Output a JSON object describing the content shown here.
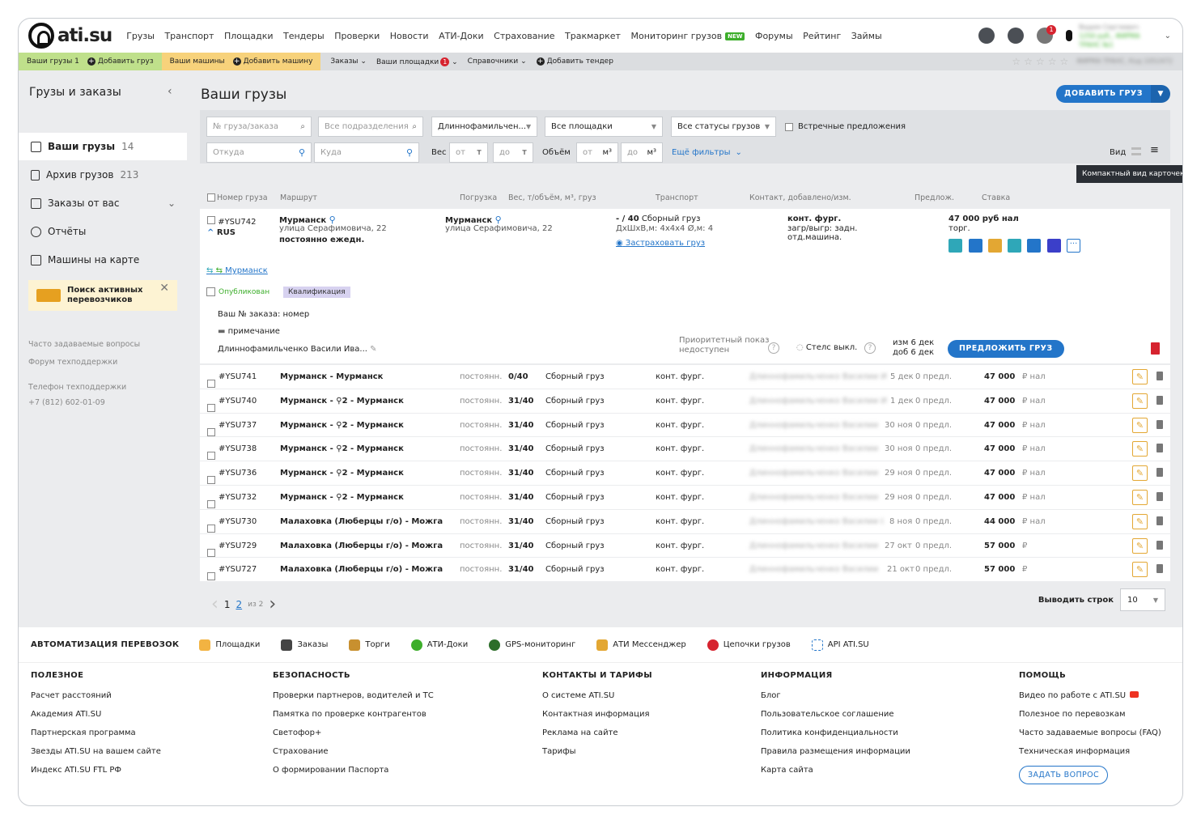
{
  "nav": {
    "logo": "ati.su",
    "items": [
      "Грузы",
      "Транспорт",
      "Площадки",
      "Тендеры",
      "Проверки",
      "Новости",
      "АТИ-Доки",
      "Страхование",
      "Тракмаркет",
      "Мониторинг грузов",
      "Форумы",
      "Рейтинг",
      "Займы"
    ],
    "new_badge": "NEW",
    "notif_count": "1",
    "user_name": "Вадим Сергеевич",
    "user_sub": "1250 руб., ФИРМА ТРАНС №1"
  },
  "subnav": {
    "cargo": "Ваши грузы 1",
    "add_cargo": "Добавить груз",
    "machines": "Ваши машины",
    "add_machine": "Добавить машину",
    "orders": "Заказы",
    "platforms": "Ваши площадки",
    "platforms_badge": "1",
    "refs": "Справочники",
    "add_tender": "Добавить тендер",
    "rating_blur": "ФИРМА ТРАНС, Код 1052472"
  },
  "sidebar": {
    "title": "Грузы и заказы",
    "items": [
      {
        "label": "Ваши грузы",
        "count": "14"
      },
      {
        "label": "Архив грузов",
        "count": "213"
      },
      {
        "label": "Заказы от вас",
        "count": ""
      },
      {
        "label": "Отчёты",
        "count": ""
      },
      {
        "label": "Машины на карте",
        "count": ""
      }
    ],
    "promo": "Поиск активных перевозчиков",
    "faq": "Часто задаваемые вопросы",
    "forum": "Форум техподдержки",
    "phone_label": "Телефон техподдержки",
    "phone": "+7 (812) 602-01-09"
  },
  "main": {
    "title": "Ваши грузы",
    "add_button": "ДОБАВИТЬ ГРУЗ"
  },
  "filters": {
    "number_ph": "№ груза/заказа",
    "division_ph": "Все подразделения",
    "person": "Длиннофамильчен...",
    "platforms": "Все площадки",
    "statuses": "Все статусы грузов",
    "counter": "Встречные предложения",
    "from_ph": "Откуда",
    "to_ph": "Куда",
    "weight": "Вес",
    "from": "от",
    "to": "до",
    "t": "т",
    "volume": "Объём",
    "m3": "м³",
    "more": "Ещё фильтры",
    "view": "Вид",
    "tooltip": "Компактный вид карточек"
  },
  "columns": [
    "Номер груза",
    "Маршрут",
    "Погрузка",
    "Вес, т/объём, м³, груз",
    "Транспорт",
    "Контакт, добавлено/изм.",
    "Предлож.",
    "Ставка"
  ],
  "card": {
    "id": "#YSU742",
    "country": "RUS",
    "from_city": "Мурманск",
    "from_addr": "улица Серафимовича, 22",
    "to_city": "Мурманск",
    "to_addr": "улица Серафимовича, 22",
    "schedule": "постоянно ежедн.",
    "weight": "- / 40",
    "cargo": "Сборный груз",
    "dims": "ДхШхВ,м: 4x4x4 Ø,м: 4",
    "insure": "Застраховать груз",
    "transport": "конт. фург.",
    "load": "загр/выгр: задн.",
    "separate": "отд.машина.",
    "rate": "47 000 руб нал",
    "trade": "торг.",
    "link": "Мурманск",
    "published": "Опубликован",
    "qualification": "Квалификация",
    "order_no": "Ваш № заказа: номер",
    "note": "примечание",
    "contact": "Длиннофамильченко Васили Ива...",
    "priority": "Приоритетный показ недоступен",
    "stealth": "Стелс выкл.",
    "changed": "изм 6 дек",
    "added": "доб 6 дек",
    "offer_button": "ПРЕДЛОЖИТЬ ГРУЗ"
  },
  "rows": [
    {
      "id": "#YSU741",
      "route": "Мурманск - Мурманск",
      "when": "постоянн.",
      "wv": "0/40",
      "cargo": "Сборный груз",
      "transport": "конт. фург.",
      "contact": "Длиннофамильченко Василии И..",
      "date": "5 дек",
      "offers": "0 предл.",
      "rate": "47 000",
      "unit": "₽ нал"
    },
    {
      "id": "#YSU740",
      "route": "Мурманск - ⚲2  - Мурманск",
      "when": "постоянн.",
      "wv": "31/40",
      "cargo": "Сборный груз",
      "transport": "конт. фург.",
      "contact": "Длиннофамильченко Василии И..",
      "date": "1 дек",
      "offers": "0 предл.",
      "rate": "47 000",
      "unit": "₽ нал"
    },
    {
      "id": "#YSU737",
      "route": "Мурманск - ⚲2  - Мурманск",
      "when": "постоянн.",
      "wv": "31/40",
      "cargo": "Сборный груз",
      "transport": "конт. фург.",
      "contact": "Длиннофамильченко Василии",
      "date": "30 ноя",
      "offers": "0 предл.",
      "rate": "47 000",
      "unit": "₽ нал"
    },
    {
      "id": "#YSU738",
      "route": "Мурманск - ⚲2  - Мурманск",
      "when": "постоянн.",
      "wv": "31/40",
      "cargo": "Сборный груз",
      "transport": "конт. фург.",
      "contact": "Длиннофамильченко Василии",
      "date": "30 ноя",
      "offers": "0 предл.",
      "rate": "47 000",
      "unit": "₽ нал"
    },
    {
      "id": "#YSU736",
      "route": "Мурманск - ⚲2  - Мурманск",
      "when": "постоянн.",
      "wv": "31/40",
      "cargo": "Сборный груз",
      "transport": "конт. фург.",
      "contact": "Длиннофамильченко Василии",
      "date": "29 ноя",
      "offers": "0 предл.",
      "rate": "47 000",
      "unit": "₽ нал"
    },
    {
      "id": "#YSU732",
      "route": "Мурманск - ⚲2  - Мурманск",
      "when": "постоянн.",
      "wv": "31/40",
      "cargo": "Сборный груз",
      "transport": "конт. фург.",
      "contact": "Длиннофамильченко Василии",
      "date": "29 ноя",
      "offers": "0 предл.",
      "rate": "47 000",
      "unit": "₽ нал"
    },
    {
      "id": "#YSU730",
      "route": "Малаховка (Люберцы г/о) - Можга",
      "when": "постоянн.",
      "wv": "31/40",
      "cargo": "Сборный груз",
      "transport": "конт. фург.",
      "contact": "Длиннофамильченко Василии И..",
      "date": "8 ноя",
      "offers": "0 предл.",
      "rate": "44 000",
      "unit": "₽ нал"
    },
    {
      "id": "#YSU729",
      "route": "Малаховка (Люберцы г/о) - Можга",
      "when": "постоянн.",
      "wv": "31/40",
      "cargo": "Сборный груз",
      "transport": "конт. фург.",
      "contact": "Длиннофамильченко Василии",
      "date": "27 окт",
      "offers": "0 предл.",
      "rate": "57 000",
      "unit": "₽"
    },
    {
      "id": "#YSU727",
      "route": "Малаховка (Люберцы г/о) - Можга",
      "when": "постоянн.",
      "wv": "31/40",
      "cargo": "Сборный груз",
      "transport": "конт. фург.",
      "contact": "Длиннофамильченко Василии",
      "date": "21 окт",
      "offers": "0 предл.",
      "rate": "57 000",
      "unit": "₽"
    }
  ],
  "pager": {
    "p1": "1",
    "p2": "2",
    "of": "из 2",
    "per_page_label": "Выводить строк",
    "per_page": "10"
  },
  "automation": {
    "title": "АВТОМАТИЗАЦИЯ ПЕРЕВОЗОК",
    "items": [
      "Площадки",
      "Заказы",
      "Торги",
      "АТИ-Доки",
      "GPS-мониторинг",
      "АТИ Мессенджер",
      "Цепочки грузов",
      "API ATI.SU"
    ]
  },
  "footer": [
    {
      "title": "ПОЛЕЗНОЕ",
      "links": [
        "Расчет расстояний",
        "Академия ATI.SU",
        "Партнерская программа",
        "Звезды ATI.SU на вашем сайте",
        "Индекс ATI.SU FTL РФ"
      ]
    },
    {
      "title": "БЕЗОПАСНОСТЬ",
      "links": [
        "Проверки партнеров, водителей и ТС",
        "Памятка по проверке контрагентов",
        "Светофор+",
        "Страхование",
        "О формировании Паспорта"
      ]
    },
    {
      "title": "КОНТАКТЫ И ТАРИФЫ",
      "links": [
        "О системе ATI.SU",
        "Контактная информация",
        "Реклама на сайте",
        "Тарифы"
      ]
    },
    {
      "title": "ИНФОРМАЦИЯ",
      "links": [
        "Блог",
        "Пользовательское соглашение",
        "Политика конфиденциальности",
        "Правила размещения информации",
        "Карта сайта"
      ]
    },
    {
      "title": "ПОМОЩЬ",
      "links": [
        "Видео по работе с ATI.SU",
        "Полезное по перевозкам",
        "Часто задаваемые вопросы (FAQ)",
        "Техническая информация"
      ],
      "button": "ЗАДАТЬ ВОПРОС"
    }
  ],
  "colors": {
    "accent": "#2375c9",
    "green": "#bfe08b",
    "orange": "#f7d27b",
    "red": "#d6232f"
  }
}
